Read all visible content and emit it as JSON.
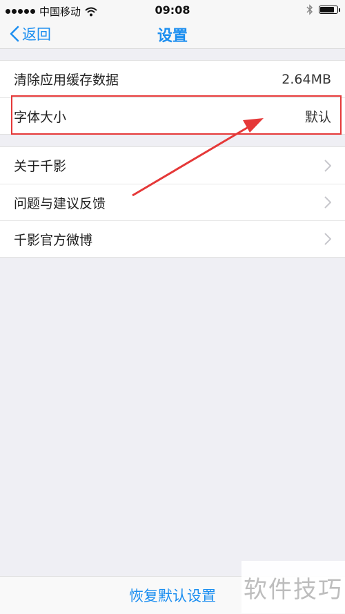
{
  "status_bar": {
    "carrier": "中国移动",
    "time": "09:08",
    "battery_level": 0.85
  },
  "nav": {
    "back_label": "返回",
    "title": "设置"
  },
  "group1": [
    {
      "label": "清除应用缓存数据",
      "value": "2.64MB"
    },
    {
      "label": "字体大小",
      "value": "默认"
    }
  ],
  "group2": [
    {
      "label": "关于千影"
    },
    {
      "label": "问题与建议反馈"
    },
    {
      "label": "千影官方微博"
    }
  ],
  "bottom": {
    "restore_label": "恢复默认设置"
  },
  "watermark": "软件技巧",
  "colors": {
    "accent": "#1b8ef0",
    "annotation": "#e53838",
    "background": "#efeff4"
  },
  "icons": [
    "signal-dots-icon",
    "wifi-icon",
    "bluetooth-icon",
    "battery-icon",
    "back-chevron-icon",
    "chevron-right-icon"
  ]
}
